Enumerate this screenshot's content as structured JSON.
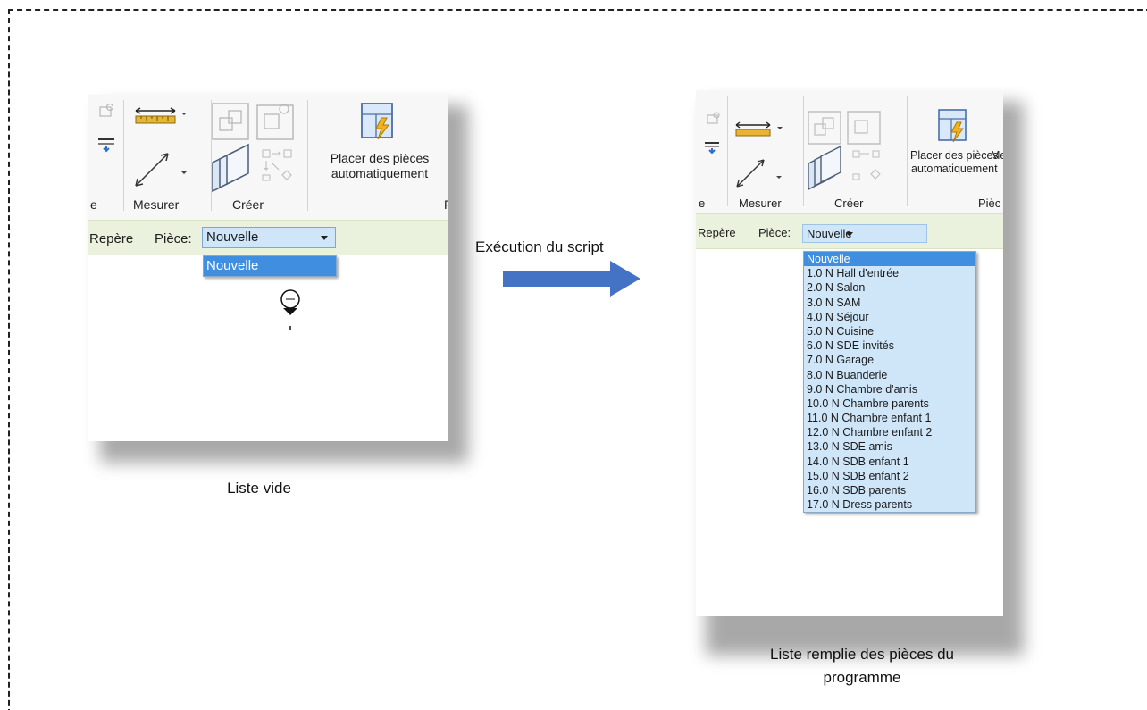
{
  "left_panel": {
    "ribbon": {
      "cut_label": "e",
      "measure_label": "Mesurer",
      "create_label": "Créer",
      "place_label_line1": "Placer des pièces",
      "place_label_line2": "automatiquement",
      "cut_right": "F"
    },
    "options": {
      "repere_label": "Repère",
      "piece_label": "Pièce:",
      "combo_value": "Nouvelle"
    },
    "dropdown_items": [
      "Nouvelle"
    ],
    "caption": "Liste vide"
  },
  "arrow_label": "Exécution du script",
  "right_panel": {
    "ribbon": {
      "cut_label": "e",
      "measure_label": "Mesurer",
      "create_label": "Créer",
      "place_label_line1": "Placer des pièces",
      "place_label_line2": "automatiquement",
      "cut_right_top": "Me",
      "cut_right": "Pièc"
    },
    "options": {
      "repere_label": "Repère",
      "piece_label": "Pièce:",
      "combo_value": "Nouvelle"
    },
    "dropdown_items": [
      "Nouvelle",
      "1.0  N Hall d'entrée",
      "2.0  N Salon",
      "3.0  N SAM",
      "4.0  N Séjour",
      "5.0  N Cuisine",
      "6.0  N SDE invités",
      "7.0  N Garage",
      "8.0  N Buanderie",
      "9.0  N Chambre d'amis",
      "10.0  N Chambre parents",
      "11.0  N Chambre enfant 1",
      "12.0  N Chambre enfant 2",
      "13.0  N SDE amis",
      "14.0  N SDB enfant 1",
      "15.0  N SDB enfant 2",
      "16.0  N SDB parents",
      "17.0  N Dress parents"
    ],
    "caption_line1": "Liste remplie des pièces du",
    "caption_line2": "programme"
  },
  "colors": {
    "arrow": "#4472c4",
    "options_bar": "#eaf2dd",
    "combo_fill": "#cfe6f9",
    "selected_row": "#3f8ee0"
  }
}
